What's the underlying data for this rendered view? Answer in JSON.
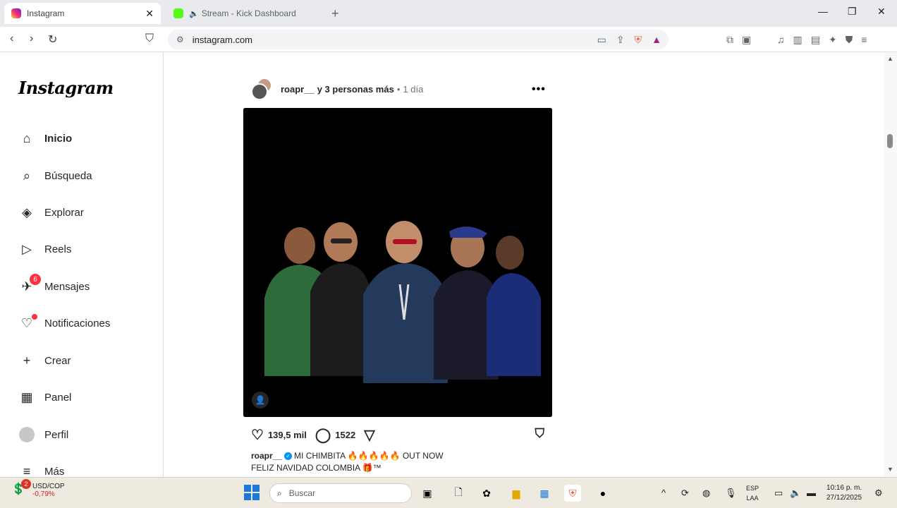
{
  "browser": {
    "tabs": [
      {
        "title": "Instagram",
        "active": true
      },
      {
        "title": "Stream - Kick Dashboard",
        "active": false
      }
    ],
    "url": "instagram.com"
  },
  "sidebar": {
    "logo": "Instagram",
    "items": [
      {
        "label": "Inicio",
        "icon": "home-icon"
      },
      {
        "label": "Búsqueda",
        "icon": "search-icon"
      },
      {
        "label": "Explorar",
        "icon": "compass-icon"
      },
      {
        "label": "Reels",
        "icon": "reels-icon"
      },
      {
        "label": "Mensajes",
        "icon": "messages-icon",
        "badge": "6"
      },
      {
        "label": "Notificaciones",
        "icon": "heart-icon"
      },
      {
        "label": "Crear",
        "icon": "plus-icon"
      },
      {
        "label": "Panel",
        "icon": "dashboard-icon"
      },
      {
        "label": "Perfil",
        "icon": "profile-icon"
      },
      {
        "label": "Más",
        "icon": "menu-icon"
      }
    ]
  },
  "post": {
    "user": "roapr__",
    "collaborators": "y 3 personas más",
    "separator": "•",
    "time": "1 día",
    "likes": "139,5 mil",
    "comments": "1522",
    "caption_user": "roapr__",
    "caption_line1": "MI CHIMBITA 🔥🔥🔥🔥🔥 OUT NOW",
    "caption_line2": "FELIZ NAVIDAD COLOMBIA 🎁™"
  },
  "taskbar": {
    "widget_badge": "2",
    "widget_pair": "USD/COP",
    "widget_change": "-0,79%",
    "search_placeholder": "Buscar",
    "lang_top": "ESP",
    "lang_bottom": "LAA",
    "time": "10:16 p. m.",
    "date": "27/12/2025"
  }
}
